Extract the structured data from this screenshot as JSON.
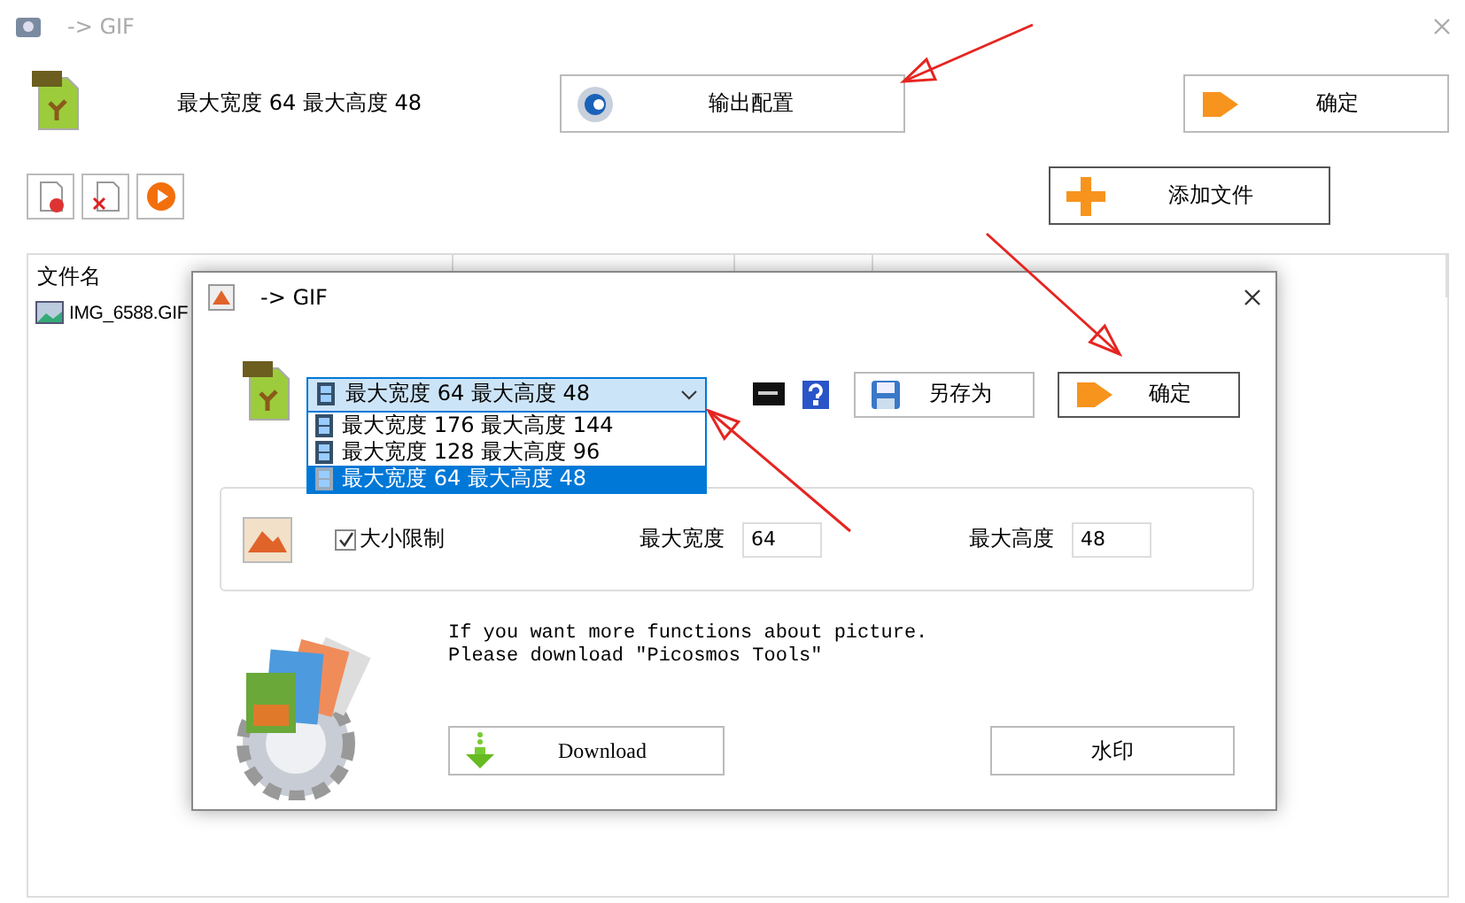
{
  "window": {
    "title": "-> GIF"
  },
  "header": {
    "size_text": "最大宽度 64 最大高度 48",
    "config_button": "输出配置",
    "ok_button": "确定",
    "add_button": "添加文件"
  },
  "file_list": {
    "columns": [
      "文件名"
    ],
    "rows": [
      {
        "name": "IMG_6588.GIF"
      }
    ]
  },
  "dialog": {
    "title": "-> GIF",
    "preset_combo": {
      "value": "最大宽度 64 最大高度 48",
      "expanded": true,
      "options": [
        {
          "label": "最大宽度 176 最大高度 144",
          "selected": false
        },
        {
          "label": "最大宽度 128 最大高度 96",
          "selected": false
        },
        {
          "label": "最大宽度 64 最大高度 48",
          "selected": true
        }
      ]
    },
    "save_as_button": "另存为",
    "ok_button": "确定",
    "size_limit": {
      "label": "大小限制",
      "checked": true
    },
    "max_width": {
      "label": "最大宽度",
      "value": "64"
    },
    "max_height": {
      "label": "最大高度",
      "value": "48"
    },
    "promo_lines": [
      "If you want more functions about picture.",
      "Please download \"Picosmos Tools\""
    ],
    "download_button": "Download",
    "watermark_button": "水印"
  }
}
